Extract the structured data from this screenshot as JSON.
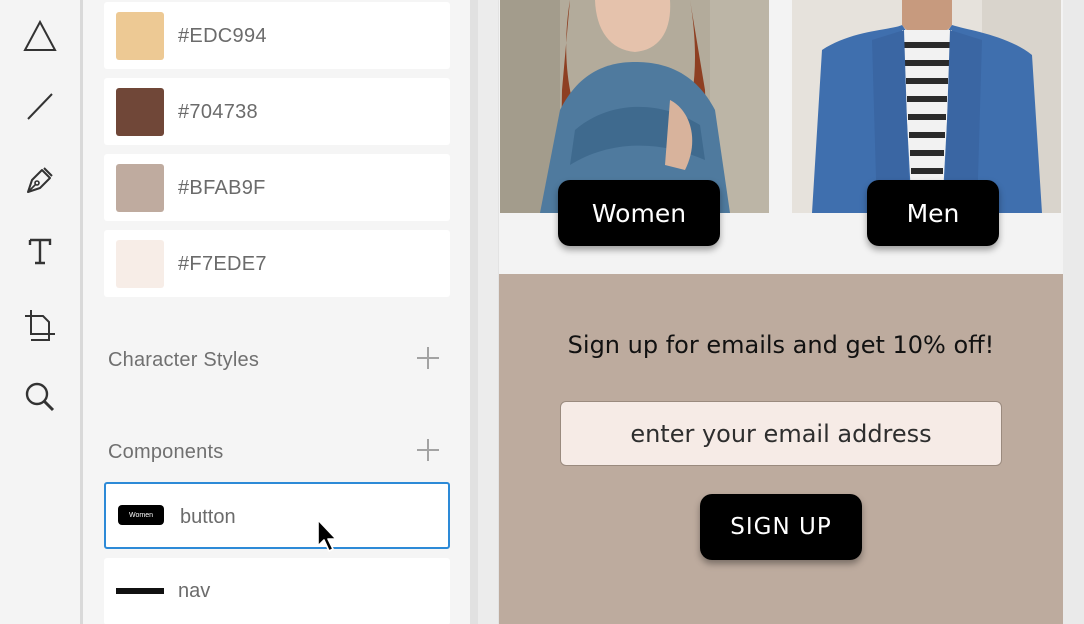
{
  "toolbar": {
    "tools": [
      {
        "name": "triangle-tool",
        "icon": "triangle-icon"
      },
      {
        "name": "line-tool",
        "icon": "line-icon"
      },
      {
        "name": "pen-tool",
        "icon": "pen-icon"
      },
      {
        "name": "text-tool",
        "icon": "text-icon",
        "glyph": "T"
      },
      {
        "name": "artboard-tool",
        "icon": "artboard-icon"
      },
      {
        "name": "zoom-tool",
        "icon": "search-icon"
      }
    ]
  },
  "assets": {
    "colors": [
      {
        "hex": "#EDC994",
        "swatch": "#EDC994"
      },
      {
        "hex": "#704738",
        "swatch": "#704738"
      },
      {
        "hex": "#BFAB9F",
        "swatch": "#BFAB9F"
      },
      {
        "hex": "#F7EDE7",
        "swatch": "#F7EDE7"
      }
    ],
    "character_styles_title": "Character Styles",
    "components_title": "Components",
    "components": [
      {
        "name": "button",
        "thumb_text": "Women",
        "selected": true
      },
      {
        "name": "nav",
        "selected": false
      }
    ]
  },
  "artboard": {
    "women_button": "Women",
    "men_button": "Men",
    "signup_text": "Sign up for emails and get 10% off!",
    "email_placeholder": "enter your email address",
    "signup_button": "SIGN UP",
    "signup_bg": "#BDAB9E"
  }
}
